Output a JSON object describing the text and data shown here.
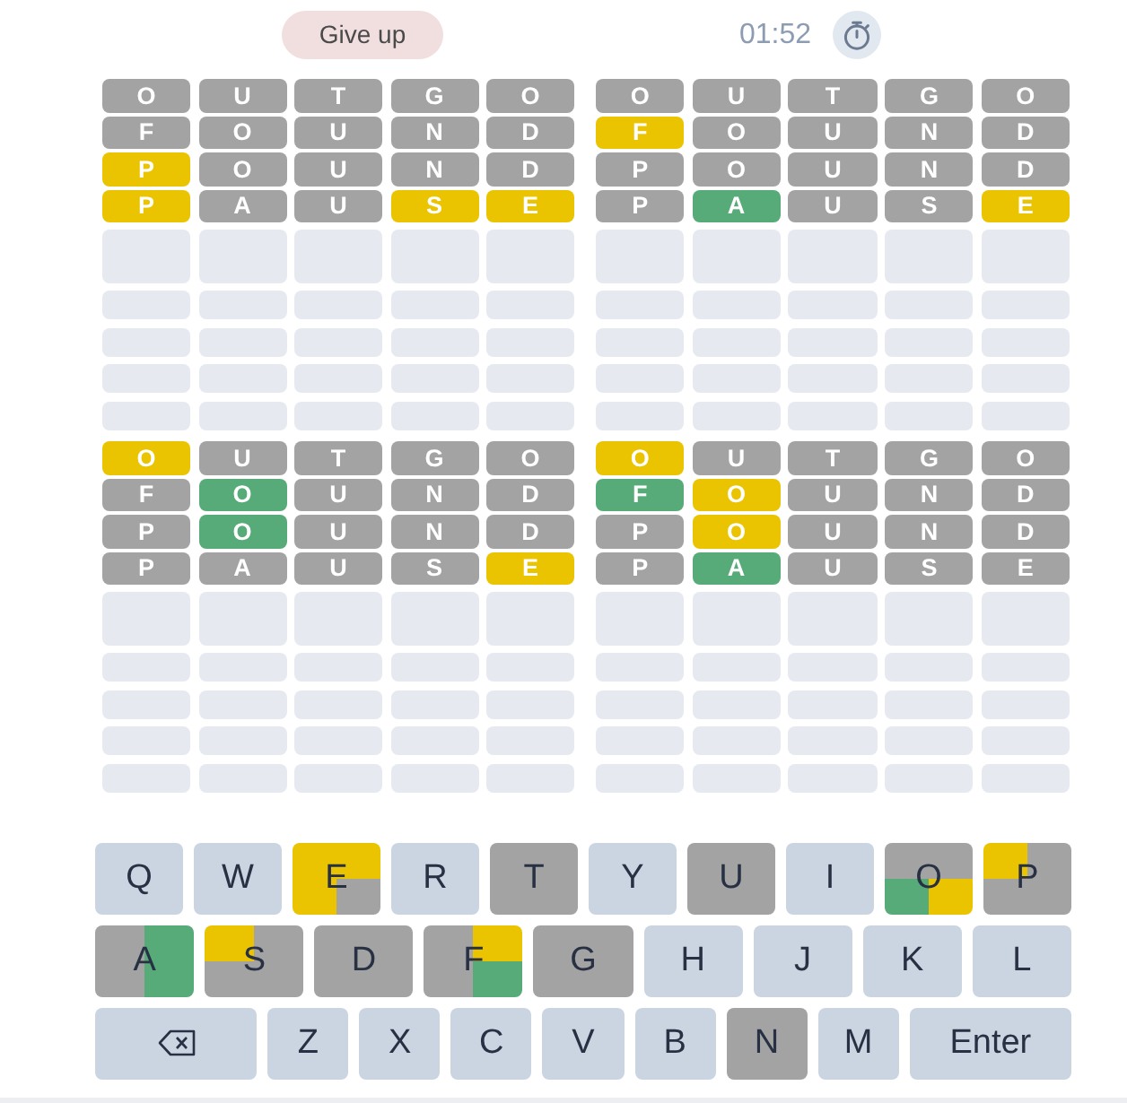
{
  "header": {
    "give_up": "Give up",
    "timer": "01:52"
  },
  "boards": [
    {
      "rows": [
        {
          "kind": "guess",
          "tiles": [
            {
              "letter": "O",
              "color": "#a3a3a3"
            },
            {
              "letter": "U",
              "color": "#a3a3a3"
            },
            {
              "letter": "T",
              "color": "#a3a3a3"
            },
            {
              "letter": "G",
              "color": "#a3a3a3"
            },
            {
              "letter": "O",
              "color": "#a3a3a3"
            }
          ]
        },
        {
          "kind": "guess",
          "tiles": [
            {
              "letter": "F",
              "color": "#a3a3a3"
            },
            {
              "letter": "O",
              "color": "#a3a3a3"
            },
            {
              "letter": "U",
              "color": "#a3a3a3"
            },
            {
              "letter": "N",
              "color": "#a3a3a3"
            },
            {
              "letter": "D",
              "color": "#a3a3a3"
            }
          ]
        },
        {
          "kind": "guess",
          "tiles": [
            {
              "letter": "P",
              "color": "#eac400"
            },
            {
              "letter": "O",
              "color": "#a3a3a3"
            },
            {
              "letter": "U",
              "color": "#a3a3a3"
            },
            {
              "letter": "N",
              "color": "#a3a3a3"
            },
            {
              "letter": "D",
              "color": "#a3a3a3"
            }
          ]
        },
        {
          "kind": "guess",
          "tiles": [
            {
              "letter": "P",
              "color": "#eac400"
            },
            {
              "letter": "A",
              "color": "#a3a3a3"
            },
            {
              "letter": "U",
              "color": "#a3a3a3"
            },
            {
              "letter": "S",
              "color": "#eac400"
            },
            {
              "letter": "E",
              "color": "#eac400"
            }
          ]
        },
        {
          "kind": "current"
        },
        {
          "kind": "empty"
        },
        {
          "kind": "empty"
        },
        {
          "kind": "empty"
        },
        {
          "kind": "empty"
        }
      ]
    },
    {
      "rows": [
        {
          "kind": "guess",
          "tiles": [
            {
              "letter": "O",
              "color": "#a3a3a3"
            },
            {
              "letter": "U",
              "color": "#a3a3a3"
            },
            {
              "letter": "T",
              "color": "#a3a3a3"
            },
            {
              "letter": "G",
              "color": "#a3a3a3"
            },
            {
              "letter": "O",
              "color": "#a3a3a3"
            }
          ]
        },
        {
          "kind": "guess",
          "tiles": [
            {
              "letter": "F",
              "color": "#eac400"
            },
            {
              "letter": "O",
              "color": "#a3a3a3"
            },
            {
              "letter": "U",
              "color": "#a3a3a3"
            },
            {
              "letter": "N",
              "color": "#a3a3a3"
            },
            {
              "letter": "D",
              "color": "#a3a3a3"
            }
          ]
        },
        {
          "kind": "guess",
          "tiles": [
            {
              "letter": "P",
              "color": "#a3a3a3"
            },
            {
              "letter": "O",
              "color": "#a3a3a3"
            },
            {
              "letter": "U",
              "color": "#a3a3a3"
            },
            {
              "letter": "N",
              "color": "#a3a3a3"
            },
            {
              "letter": "D",
              "color": "#a3a3a3"
            }
          ]
        },
        {
          "kind": "guess",
          "tiles": [
            {
              "letter": "P",
              "color": "#a3a3a3"
            },
            {
              "letter": "A",
              "color": "#57ab78"
            },
            {
              "letter": "U",
              "color": "#a3a3a3"
            },
            {
              "letter": "S",
              "color": "#a3a3a3"
            },
            {
              "letter": "E",
              "color": "#eac400"
            }
          ]
        },
        {
          "kind": "current"
        },
        {
          "kind": "empty"
        },
        {
          "kind": "empty"
        },
        {
          "kind": "empty"
        },
        {
          "kind": "empty"
        }
      ]
    },
    {
      "rows": [
        {
          "kind": "guess",
          "tiles": [
            {
              "letter": "O",
              "color": "#eac400"
            },
            {
              "letter": "U",
              "color": "#a3a3a3"
            },
            {
              "letter": "T",
              "color": "#a3a3a3"
            },
            {
              "letter": "G",
              "color": "#a3a3a3"
            },
            {
              "letter": "O",
              "color": "#a3a3a3"
            }
          ]
        },
        {
          "kind": "guess",
          "tiles": [
            {
              "letter": "F",
              "color": "#a3a3a3"
            },
            {
              "letter": "O",
              "color": "#57ab78"
            },
            {
              "letter": "U",
              "color": "#a3a3a3"
            },
            {
              "letter": "N",
              "color": "#a3a3a3"
            },
            {
              "letter": "D",
              "color": "#a3a3a3"
            }
          ]
        },
        {
          "kind": "guess",
          "tiles": [
            {
              "letter": "P",
              "color": "#a3a3a3"
            },
            {
              "letter": "O",
              "color": "#57ab78"
            },
            {
              "letter": "U",
              "color": "#a3a3a3"
            },
            {
              "letter": "N",
              "color": "#a3a3a3"
            },
            {
              "letter": "D",
              "color": "#a3a3a3"
            }
          ]
        },
        {
          "kind": "guess",
          "tiles": [
            {
              "letter": "P",
              "color": "#a3a3a3"
            },
            {
              "letter": "A",
              "color": "#a3a3a3"
            },
            {
              "letter": "U",
              "color": "#a3a3a3"
            },
            {
              "letter": "S",
              "color": "#a3a3a3"
            },
            {
              "letter": "E",
              "color": "#eac400"
            }
          ]
        },
        {
          "kind": "current"
        },
        {
          "kind": "empty"
        },
        {
          "kind": "empty"
        },
        {
          "kind": "empty"
        },
        {
          "kind": "empty"
        }
      ]
    },
    {
      "rows": [
        {
          "kind": "guess",
          "tiles": [
            {
              "letter": "O",
              "color": "#eac400"
            },
            {
              "letter": "U",
              "color": "#a3a3a3"
            },
            {
              "letter": "T",
              "color": "#a3a3a3"
            },
            {
              "letter": "G",
              "color": "#a3a3a3"
            },
            {
              "letter": "O",
              "color": "#a3a3a3"
            }
          ]
        },
        {
          "kind": "guess",
          "tiles": [
            {
              "letter": "F",
              "color": "#57ab78"
            },
            {
              "letter": "O",
              "color": "#eac400"
            },
            {
              "letter": "U",
              "color": "#a3a3a3"
            },
            {
              "letter": "N",
              "color": "#a3a3a3"
            },
            {
              "letter": "D",
              "color": "#a3a3a3"
            }
          ]
        },
        {
          "kind": "guess",
          "tiles": [
            {
              "letter": "P",
              "color": "#a3a3a3"
            },
            {
              "letter": "O",
              "color": "#eac400"
            },
            {
              "letter": "U",
              "color": "#a3a3a3"
            },
            {
              "letter": "N",
              "color": "#a3a3a3"
            },
            {
              "letter": "D",
              "color": "#a3a3a3"
            }
          ]
        },
        {
          "kind": "guess",
          "tiles": [
            {
              "letter": "P",
              "color": "#a3a3a3"
            },
            {
              "letter": "A",
              "color": "#57ab78"
            },
            {
              "letter": "U",
              "color": "#a3a3a3"
            },
            {
              "letter": "S",
              "color": "#a3a3a3"
            },
            {
              "letter": "E",
              "color": "#a3a3a3"
            }
          ]
        },
        {
          "kind": "current"
        },
        {
          "kind": "empty"
        },
        {
          "kind": "empty"
        },
        {
          "kind": "empty"
        },
        {
          "kind": "empty"
        }
      ]
    }
  ],
  "keyboard": {
    "rows": [
      {
        "keys": [
          {
            "kind": "letter",
            "label": "Q",
            "color": "#cbd5e1"
          },
          {
            "kind": "letter",
            "label": "W",
            "color": "#cbd5e1"
          },
          {
            "kind": "letter",
            "label": "E",
            "quadrants": [
              {
                "color": "#eac400"
              },
              {
                "color": "#eac400"
              },
              {
                "color": "#eac400"
              },
              {
                "color": "#a3a3a3"
              }
            ]
          },
          {
            "kind": "letter",
            "label": "R",
            "color": "#cbd5e1"
          },
          {
            "kind": "letter",
            "label": "T",
            "color": "#a3a3a3"
          },
          {
            "kind": "letter",
            "label": "Y",
            "color": "#cbd5e1"
          },
          {
            "kind": "letter",
            "label": "U",
            "color": "#a3a3a3"
          },
          {
            "kind": "letter",
            "label": "I",
            "color": "#cbd5e1"
          },
          {
            "kind": "letter",
            "label": "O",
            "quadrants": [
              {
                "color": "#a3a3a3"
              },
              {
                "color": "#a3a3a3"
              },
              {
                "color": "#57ab78"
              },
              {
                "color": "#eac400"
              }
            ]
          },
          {
            "kind": "letter",
            "label": "P",
            "quadrants": [
              {
                "color": "#eac400"
              },
              {
                "color": "#a3a3a3"
              },
              {
                "color": "#a3a3a3"
              },
              {
                "color": "#a3a3a3"
              }
            ]
          }
        ]
      },
      {
        "keys": [
          {
            "kind": "letter",
            "label": "A",
            "quadrants": [
              {
                "color": "#a3a3a3"
              },
              {
                "color": "#57ab78"
              },
              {
                "color": "#a3a3a3"
              },
              {
                "color": "#57ab78"
              }
            ]
          },
          {
            "kind": "letter",
            "label": "S",
            "quadrants": [
              {
                "color": "#eac400"
              },
              {
                "color": "#a3a3a3"
              },
              {
                "color": "#a3a3a3"
              },
              {
                "color": "#a3a3a3"
              }
            ]
          },
          {
            "kind": "letter",
            "label": "D",
            "color": "#a3a3a3"
          },
          {
            "kind": "letter",
            "label": "F",
            "quadrants": [
              {
                "color": "#a3a3a3"
              },
              {
                "color": "#eac400"
              },
              {
                "color": "#a3a3a3"
              },
              {
                "color": "#57ab78"
              }
            ]
          },
          {
            "kind": "letter",
            "label": "G",
            "color": "#a3a3a3"
          },
          {
            "kind": "letter",
            "label": "H",
            "color": "#cbd5e1"
          },
          {
            "kind": "letter",
            "label": "J",
            "color": "#cbd5e1"
          },
          {
            "kind": "letter",
            "label": "K",
            "color": "#cbd5e1"
          },
          {
            "kind": "letter",
            "label": "L",
            "color": "#cbd5e1"
          }
        ]
      },
      {
        "keys": [
          {
            "kind": "backspace"
          },
          {
            "kind": "letter",
            "label": "Z",
            "color": "#cbd5e1"
          },
          {
            "kind": "letter",
            "label": "X",
            "color": "#cbd5e1"
          },
          {
            "kind": "letter",
            "label": "C",
            "color": "#cbd5e1"
          },
          {
            "kind": "letter",
            "label": "V",
            "color": "#cbd5e1"
          },
          {
            "kind": "letter",
            "label": "B",
            "color": "#cbd5e1"
          },
          {
            "kind": "letter",
            "label": "N",
            "color": "#a3a3a3"
          },
          {
            "kind": "letter",
            "label": "M",
            "color": "#cbd5e1"
          },
          {
            "kind": "enter",
            "label": "Enter"
          }
        ]
      }
    ]
  }
}
